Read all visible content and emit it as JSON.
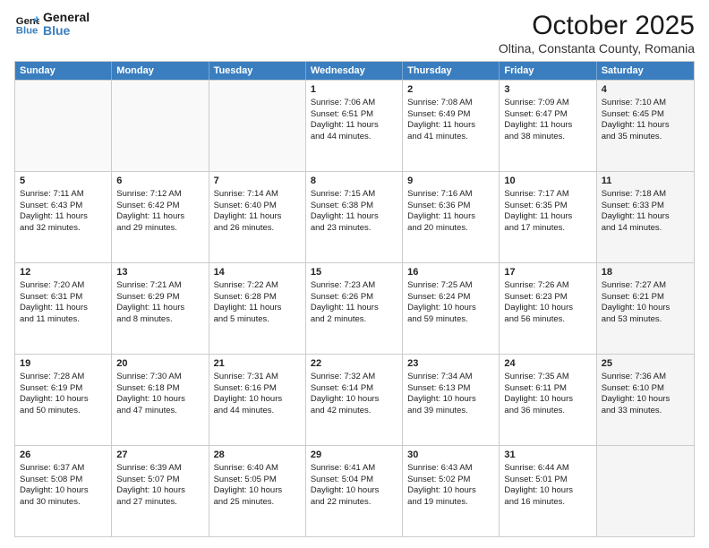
{
  "header": {
    "logo_line1": "General",
    "logo_line2": "Blue",
    "title": "October 2025",
    "subtitle": "Oltina, Constanta County, Romania"
  },
  "days_of_week": [
    "Sunday",
    "Monday",
    "Tuesday",
    "Wednesday",
    "Thursday",
    "Friday",
    "Saturday"
  ],
  "weeks": [
    [
      {
        "day": "",
        "info": "",
        "empty": true
      },
      {
        "day": "",
        "info": "",
        "empty": true
      },
      {
        "day": "",
        "info": "",
        "empty": true
      },
      {
        "day": "1",
        "info": "Sunrise: 7:06 AM\nSunset: 6:51 PM\nDaylight: 11 hours and 44 minutes.",
        "empty": false
      },
      {
        "day": "2",
        "info": "Sunrise: 7:08 AM\nSunset: 6:49 PM\nDaylight: 11 hours and 41 minutes.",
        "empty": false
      },
      {
        "day": "3",
        "info": "Sunrise: 7:09 AM\nSunset: 6:47 PM\nDaylight: 11 hours and 38 minutes.",
        "empty": false
      },
      {
        "day": "4",
        "info": "Sunrise: 7:10 AM\nSunset: 6:45 PM\nDaylight: 11 hours and 35 minutes.",
        "empty": false,
        "shaded": true
      }
    ],
    [
      {
        "day": "5",
        "info": "Sunrise: 7:11 AM\nSunset: 6:43 PM\nDaylight: 11 hours and 32 minutes.",
        "empty": false
      },
      {
        "day": "6",
        "info": "Sunrise: 7:12 AM\nSunset: 6:42 PM\nDaylight: 11 hours and 29 minutes.",
        "empty": false
      },
      {
        "day": "7",
        "info": "Sunrise: 7:14 AM\nSunset: 6:40 PM\nDaylight: 11 hours and 26 minutes.",
        "empty": false
      },
      {
        "day": "8",
        "info": "Sunrise: 7:15 AM\nSunset: 6:38 PM\nDaylight: 11 hours and 23 minutes.",
        "empty": false
      },
      {
        "day": "9",
        "info": "Sunrise: 7:16 AM\nSunset: 6:36 PM\nDaylight: 11 hours and 20 minutes.",
        "empty": false
      },
      {
        "day": "10",
        "info": "Sunrise: 7:17 AM\nSunset: 6:35 PM\nDaylight: 11 hours and 17 minutes.",
        "empty": false
      },
      {
        "day": "11",
        "info": "Sunrise: 7:18 AM\nSunset: 6:33 PM\nDaylight: 11 hours and 14 minutes.",
        "empty": false,
        "shaded": true
      }
    ],
    [
      {
        "day": "12",
        "info": "Sunrise: 7:20 AM\nSunset: 6:31 PM\nDaylight: 11 hours and 11 minutes.",
        "empty": false
      },
      {
        "day": "13",
        "info": "Sunrise: 7:21 AM\nSunset: 6:29 PM\nDaylight: 11 hours and 8 minutes.",
        "empty": false
      },
      {
        "day": "14",
        "info": "Sunrise: 7:22 AM\nSunset: 6:28 PM\nDaylight: 11 hours and 5 minutes.",
        "empty": false
      },
      {
        "day": "15",
        "info": "Sunrise: 7:23 AM\nSunset: 6:26 PM\nDaylight: 11 hours and 2 minutes.",
        "empty": false
      },
      {
        "day": "16",
        "info": "Sunrise: 7:25 AM\nSunset: 6:24 PM\nDaylight: 10 hours and 59 minutes.",
        "empty": false
      },
      {
        "day": "17",
        "info": "Sunrise: 7:26 AM\nSunset: 6:23 PM\nDaylight: 10 hours and 56 minutes.",
        "empty": false
      },
      {
        "day": "18",
        "info": "Sunrise: 7:27 AM\nSunset: 6:21 PM\nDaylight: 10 hours and 53 minutes.",
        "empty": false,
        "shaded": true
      }
    ],
    [
      {
        "day": "19",
        "info": "Sunrise: 7:28 AM\nSunset: 6:19 PM\nDaylight: 10 hours and 50 minutes.",
        "empty": false
      },
      {
        "day": "20",
        "info": "Sunrise: 7:30 AM\nSunset: 6:18 PM\nDaylight: 10 hours and 47 minutes.",
        "empty": false
      },
      {
        "day": "21",
        "info": "Sunrise: 7:31 AM\nSunset: 6:16 PM\nDaylight: 10 hours and 44 minutes.",
        "empty": false
      },
      {
        "day": "22",
        "info": "Sunrise: 7:32 AM\nSunset: 6:14 PM\nDaylight: 10 hours and 42 minutes.",
        "empty": false
      },
      {
        "day": "23",
        "info": "Sunrise: 7:34 AM\nSunset: 6:13 PM\nDaylight: 10 hours and 39 minutes.",
        "empty": false
      },
      {
        "day": "24",
        "info": "Sunrise: 7:35 AM\nSunset: 6:11 PM\nDaylight: 10 hours and 36 minutes.",
        "empty": false
      },
      {
        "day": "25",
        "info": "Sunrise: 7:36 AM\nSunset: 6:10 PM\nDaylight: 10 hours and 33 minutes.",
        "empty": false,
        "shaded": true
      }
    ],
    [
      {
        "day": "26",
        "info": "Sunrise: 6:37 AM\nSunset: 5:08 PM\nDaylight: 10 hours and 30 minutes.",
        "empty": false
      },
      {
        "day": "27",
        "info": "Sunrise: 6:39 AM\nSunset: 5:07 PM\nDaylight: 10 hours and 27 minutes.",
        "empty": false
      },
      {
        "day": "28",
        "info": "Sunrise: 6:40 AM\nSunset: 5:05 PM\nDaylight: 10 hours and 25 minutes.",
        "empty": false
      },
      {
        "day": "29",
        "info": "Sunrise: 6:41 AM\nSunset: 5:04 PM\nDaylight: 10 hours and 22 minutes.",
        "empty": false
      },
      {
        "day": "30",
        "info": "Sunrise: 6:43 AM\nSunset: 5:02 PM\nDaylight: 10 hours and 19 minutes.",
        "empty": false
      },
      {
        "day": "31",
        "info": "Sunrise: 6:44 AM\nSunset: 5:01 PM\nDaylight: 10 hours and 16 minutes.",
        "empty": false
      },
      {
        "day": "",
        "info": "",
        "empty": true,
        "shaded": true
      }
    ]
  ]
}
